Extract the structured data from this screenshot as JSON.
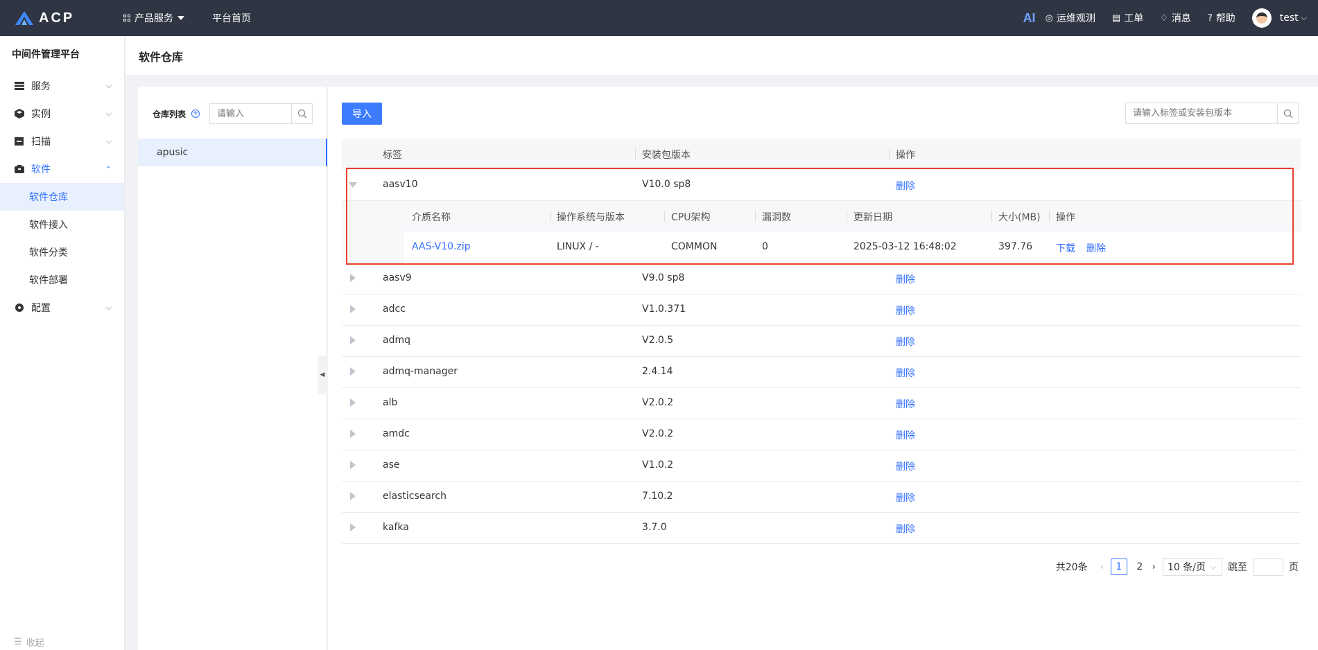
{
  "topbar": {
    "logo_text": "ACP",
    "nav": [
      {
        "label": "产品服务"
      },
      {
        "label": "平台首页"
      }
    ],
    "ai_label": "AI",
    "right_items": [
      {
        "label": "运维观测",
        "icon": "location-eye-icon"
      },
      {
        "label": "工单",
        "icon": "clipboard-icon"
      },
      {
        "label": "消息",
        "icon": "bell-icon"
      },
      {
        "label": "帮助",
        "icon": "help-icon"
      }
    ],
    "user": "test"
  },
  "sidebar": {
    "platform_title": "中间件管理平台",
    "items": [
      {
        "label": "服务",
        "icon": "server-icon"
      },
      {
        "label": "实例",
        "icon": "cube-icon"
      },
      {
        "label": "扫描",
        "icon": "scan-icon"
      },
      {
        "label": "软件",
        "icon": "box-icon"
      }
    ],
    "sub_items": [
      {
        "label": "软件仓库"
      },
      {
        "label": "软件接入"
      },
      {
        "label": "软件分类"
      },
      {
        "label": "软件部署"
      }
    ],
    "config_label": "配置",
    "collapse_label": "收起"
  },
  "page": {
    "title": "软件仓库"
  },
  "repo_panel": {
    "label": "仓库列表",
    "search_placeholder": "请输入",
    "repos": [
      "apusic"
    ]
  },
  "main": {
    "import_label": "导入",
    "search_placeholder": "请输入标签或安装包版本",
    "headers": {
      "tag": "标签",
      "version": "安装包版本",
      "action": "操作"
    },
    "rows": [
      {
        "tag": "aasv10",
        "version": "V10.0 sp8",
        "action": "删除",
        "expanded": true
      },
      {
        "tag": "aasv9",
        "version": "V9.0 sp8",
        "action": "删除"
      },
      {
        "tag": "adcc",
        "version": "V1.0.371",
        "action": "删除"
      },
      {
        "tag": "admq",
        "version": "V2.0.5",
        "action": "删除"
      },
      {
        "tag": "admq-manager",
        "version": "2.4.14",
        "action": "删除"
      },
      {
        "tag": "alb",
        "version": "V2.0.2",
        "action": "删除"
      },
      {
        "tag": "amdc",
        "version": "V2.0.2",
        "action": "删除"
      },
      {
        "tag": "ase",
        "version": "V1.0.2",
        "action": "删除"
      },
      {
        "tag": "elasticsearch",
        "version": "7.10.2",
        "action": "删除"
      },
      {
        "tag": "kafka",
        "version": "3.7.0",
        "action": "删除"
      }
    ],
    "sub_headers": {
      "name": "介质名称",
      "os": "操作系统与版本",
      "cpu": "CPU架构",
      "vulns": "漏洞数",
      "updated": "更新日期",
      "size": "大小(MB)",
      "action": "操作"
    },
    "sub_row": {
      "name": "AAS-V10.zip",
      "os": "LINUX / -",
      "cpu": "COMMON",
      "vulns": "0",
      "updated": "2025-03-12 16:48:02",
      "size": "397.76",
      "download": "下载",
      "delete": "删除"
    },
    "pager": {
      "total": "共20条",
      "pages": [
        "1",
        "2"
      ],
      "current": "1",
      "page_size": "10 条/页",
      "jump_label": "跳至",
      "page_suffix": "页"
    }
  },
  "colors": {
    "topbar": "#2f3542",
    "accent": "#3370ff",
    "highlight": "#e8412c"
  }
}
